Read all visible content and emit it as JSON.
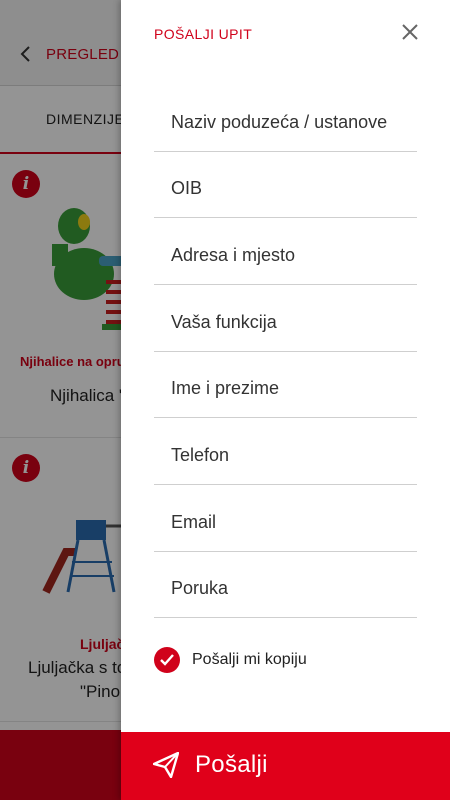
{
  "background": {
    "back_label": "PREGLED",
    "tab_label": "DIMENZIJE",
    "cards": [
      {
        "info": "i",
        "category": "Njihalice na opruz",
        "name": "Njihalica \""
      },
      {
        "info": "i",
        "category": "Ljuljač",
        "name_line1": "Ljuljačka s to",
        "name_line2": "\"Pinol"
      }
    ]
  },
  "drawer": {
    "title": "POŠALJI UPIT",
    "fields": [
      {
        "placeholder": "Naziv poduzeća / ustanove"
      },
      {
        "placeholder": "OIB"
      },
      {
        "placeholder": "Adresa i mjesto"
      },
      {
        "placeholder": "Vaša funkcija"
      },
      {
        "placeholder": "Ime i prezime"
      },
      {
        "placeholder": "Telefon"
      },
      {
        "placeholder": "Email"
      },
      {
        "placeholder": "Poruka"
      }
    ],
    "copy_checkbox": {
      "label": "Pošalji mi kopiju",
      "checked": true
    },
    "send_label": "Pošalji"
  },
  "colors": {
    "accent": "#d0021b",
    "button": "#e0001a"
  }
}
